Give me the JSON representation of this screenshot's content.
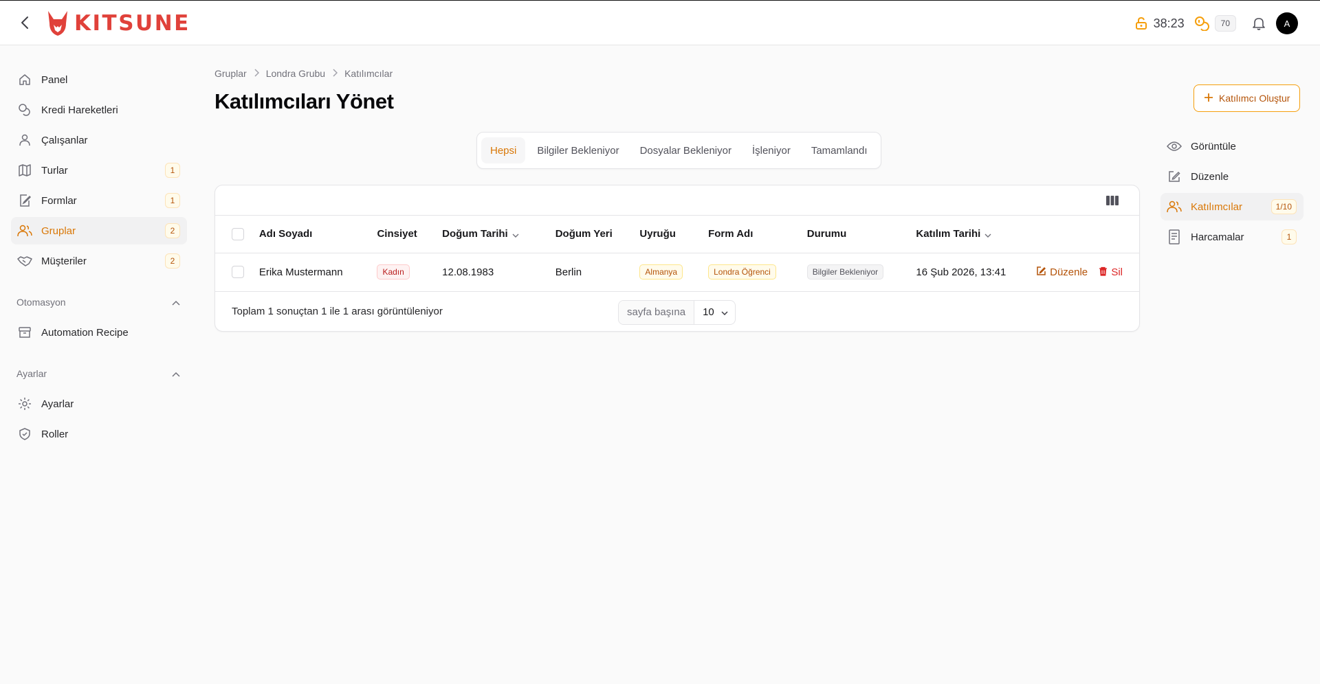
{
  "header": {
    "logo_text": "KITSUNE",
    "timer": "38:23",
    "coins": "70",
    "avatar_initial": "A"
  },
  "sidebar": {
    "items": [
      {
        "label": "Panel",
        "icon": "home-icon"
      },
      {
        "label": "Kredi Hareketleri",
        "icon": "coins-icon"
      },
      {
        "label": "Çalışanlar",
        "icon": "user-icon"
      },
      {
        "label": "Turlar",
        "icon": "map-icon",
        "badge": "1"
      },
      {
        "label": "Formlar",
        "icon": "form-edit-icon",
        "badge": "1"
      },
      {
        "label": "Gruplar",
        "icon": "users-icon",
        "badge": "2"
      },
      {
        "label": "Müşteriler",
        "icon": "handshake-icon",
        "badge": "2"
      }
    ],
    "groups": [
      {
        "title": "Otomasyon",
        "items": [
          {
            "label": "Automation Recipe",
            "icon": "archive-icon"
          }
        ]
      },
      {
        "title": "Ayarlar",
        "items": [
          {
            "label": "Ayarlar",
            "icon": "gear-icon"
          },
          {
            "label": "Roller",
            "icon": "shield-check-icon"
          }
        ]
      }
    ]
  },
  "breadcrumb": [
    "Gruplar",
    "Londra Grubu",
    "Katılımcılar"
  ],
  "page_title": "Katılımcıları Yönet",
  "create_button": "Katılımcı Oluştur",
  "tabs": [
    "Hepsi",
    "Bilgiler Bekleniyor",
    "Dosyalar Bekleniyor",
    "İşleniyor",
    "Tamamlandı"
  ],
  "table": {
    "columns": [
      "Adı Soyadı",
      "Cinsiyet",
      "Doğum Tarihi",
      "Doğum Yeri",
      "Uyruğu",
      "Form Adı",
      "Durumu",
      "Katılım Tarihi"
    ],
    "rows": [
      {
        "name": "Erika Mustermann",
        "gender": "Kadın",
        "birth_date": "12.08.1983",
        "birth_place": "Berlin",
        "nationality": "Almanya",
        "form": "Londra Öğrenci",
        "status": "Bilgiler Bekleniyor",
        "joined": "16 Şub 2026, 13:41"
      }
    ],
    "edit_label": "Düzenle",
    "delete_label": "Sil"
  },
  "footer": {
    "summary": "Toplam 1 sonuçtan 1 ile 1 arası görüntüleniyor",
    "per_page_label": "sayfa başına",
    "per_page_value": "10"
  },
  "right_nav": [
    {
      "label": "Görüntüle",
      "icon": "eye-icon"
    },
    {
      "label": "Düzenle",
      "icon": "pencil-square-icon"
    },
    {
      "label": "Katılımcılar",
      "icon": "users-icon",
      "badge": "1/10"
    },
    {
      "label": "Harcamalar",
      "icon": "receipt-icon",
      "badge": "1"
    }
  ],
  "colors": {
    "accent": "#d97706",
    "brand": "#e0413a"
  }
}
